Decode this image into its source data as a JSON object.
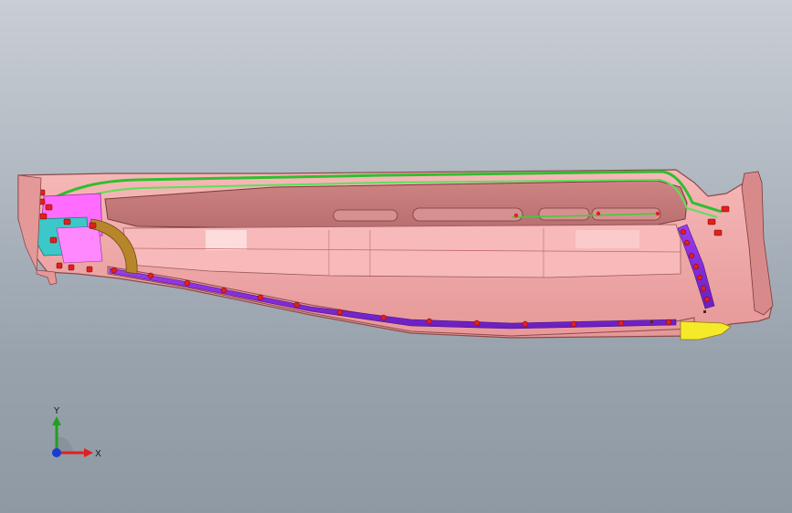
{
  "triad": {
    "x_label": "X",
    "y_label": "Y"
  },
  "colors": {
    "body": "#f0a8a8",
    "body_edge": "#8a4a4a",
    "body_dark": "#d58a8a",
    "wire": "#33cc33",
    "strip": "#8a2be2",
    "led": "#e02020",
    "magenta": "#ff66ff",
    "cyan": "#33cccc",
    "bezel": "#b8860b",
    "tip": "#f5ea2a",
    "axis_x": "#e02020",
    "axis_y": "#20a020",
    "axis_z": "#1a3cd0"
  },
  "icons": {
    "model": "headlamp-assembly-model",
    "triad": "coordinate-triad-icon"
  }
}
